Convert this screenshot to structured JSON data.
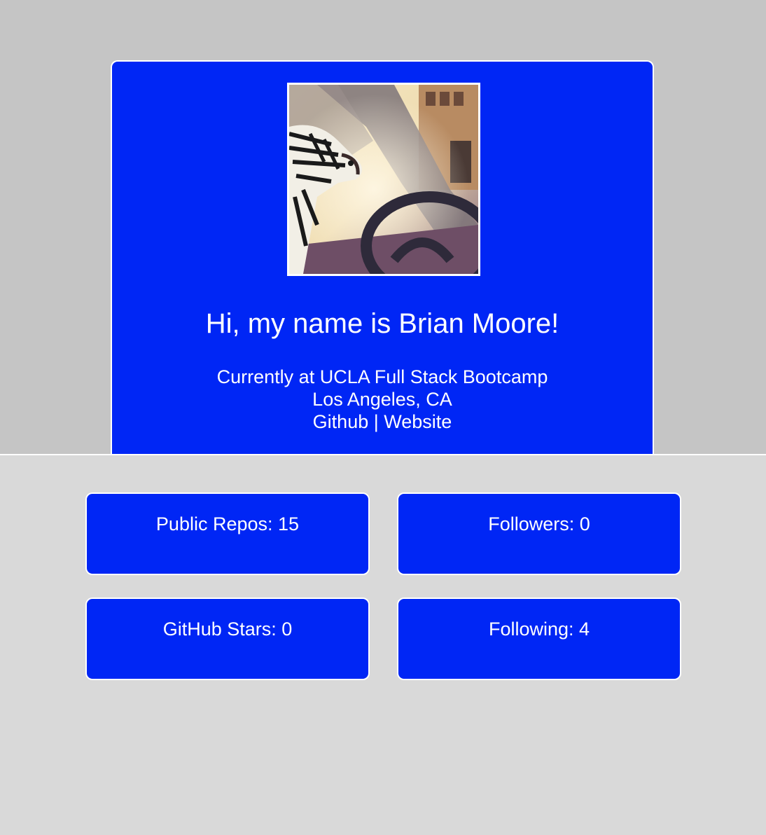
{
  "profile": {
    "avatar_alt": "zebra-in-car-photo",
    "greeting": "Hi, my name is Brian Moore!",
    "current": "Currently at UCLA Full Stack Bootcamp",
    "location": "Los Angeles, CA",
    "github_link": "Github",
    "separator": " | ",
    "website_link": "Website"
  },
  "stats": {
    "repos_label": "Public Repos: ",
    "repos_value": "15",
    "followers_label": "Followers: ",
    "followers_value": "0",
    "stars_label": "GitHub Stars: ",
    "stars_value": "0",
    "following_label": "Following: ",
    "following_value": "4"
  },
  "colors": {
    "card_bg": "#0026f5",
    "top_band_bg": "#c5c5c5",
    "page_bg": "#d9d9d9",
    "text": "#ffffff"
  }
}
